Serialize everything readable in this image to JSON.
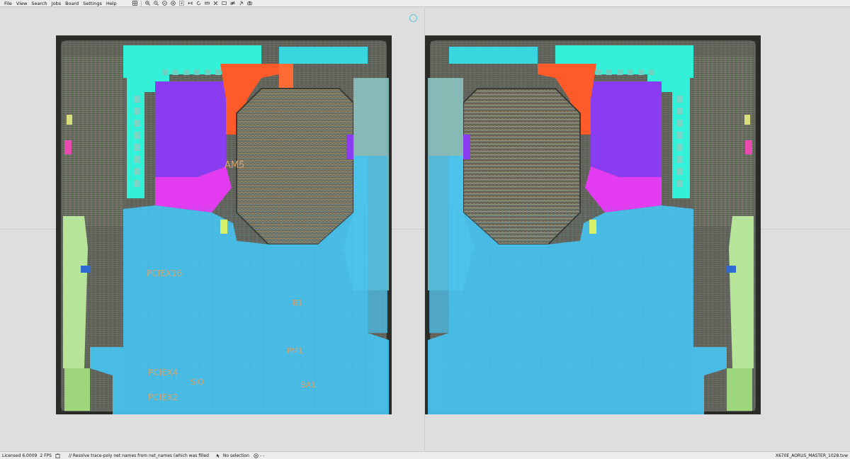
{
  "menu": [
    "File",
    "View",
    "Search",
    "Jobs",
    "Board",
    "Settings",
    "Help"
  ],
  "toolbar_icons": [
    "grid-icon",
    "zoom-in-icon",
    "zoom-out-icon",
    "zoom-fit-icon",
    "zoom-area-icon",
    "select-icon",
    "flip-icon",
    "rotate-icon",
    "measure-icon",
    "close-icon",
    "hide-icon",
    "eye-icon",
    "pin-icon",
    "camera-icon"
  ],
  "board_labels": {
    "am5": "AM5",
    "pciex16": "PCIEX16",
    "pciex4": "PCIEX4",
    "pciex2": "PCIEX2",
    "sio": "SIO",
    "pm1": "PM1",
    "ba1": "BA1",
    "b1": "B1"
  },
  "status": {
    "license": "Licensed  6.0009",
    "fps": "2 FPS",
    "log": "// Resolve trace-poly net names from net_names (which was filled",
    "selection": "No selection",
    "dash": "- -",
    "file": "X670E_AORUS_MASTER_1028.tvw"
  },
  "colors": {
    "board_frame": "#2b2b28",
    "board_bg": "#595957",
    "copper_blue": "#46c3f0",
    "cyan": "#33f0d8",
    "purple": "#8a3cf0",
    "magenta": "#e33cf0",
    "orange": "#ff5a2a",
    "green": "#b6e59a"
  }
}
